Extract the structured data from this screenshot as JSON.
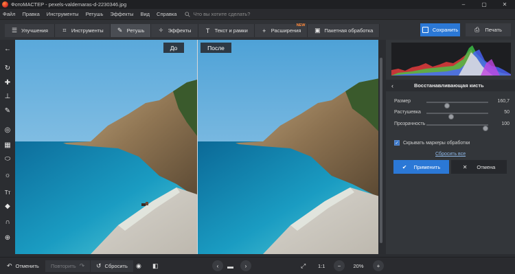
{
  "window": {
    "title": "ФотоМАСТЕР - pexels-valdemaras-d-2230346.jpg",
    "minimize": "–",
    "maximize": "▢",
    "close": "✕"
  },
  "menu": {
    "items": [
      "Файл",
      "Правка",
      "Инструменты",
      "Ретушь",
      "Эффекты",
      "Вид",
      "Справка"
    ],
    "search_placeholder": "Что вы хотите сделать?",
    "search_icon": "search-icon"
  },
  "toolbar": {
    "tabs": [
      {
        "label": "Улучшения",
        "icon": "sliders-icon"
      },
      {
        "label": "Инструменты",
        "icon": "crop-icon"
      },
      {
        "label": "Ретушь",
        "icon": "brush-icon",
        "active": true
      },
      {
        "label": "Эффекты",
        "icon": "sparkle-icon"
      },
      {
        "label": "Текст и рамки",
        "icon": "text-icon"
      },
      {
        "label": "Расширения",
        "icon": "plus-icon",
        "badge": "NEW"
      },
      {
        "label": "Пакетная обработка",
        "icon": "batch-icon"
      }
    ],
    "save_label": "Сохранить",
    "print_label": "Печать"
  },
  "left_tools": [
    {
      "name": "back-arrow-icon",
      "glyph": "←"
    },
    {
      "name": "rotate-icon",
      "glyph": "↻"
    },
    {
      "name": "bandage-icon",
      "glyph": "✚"
    },
    {
      "name": "stamp-icon",
      "glyph": "⊥"
    },
    {
      "name": "brush-icon",
      "glyph": "✎"
    },
    {
      "name": "target-brush-icon",
      "glyph": "◎"
    },
    {
      "name": "gradient-icon",
      "glyph": "▦"
    },
    {
      "name": "vignette-icon",
      "glyph": "⬭"
    },
    {
      "name": "sun-icon",
      "glyph": "☼"
    },
    {
      "name": "text-tool-icon",
      "glyph": "Tт"
    },
    {
      "name": "fill-icon",
      "glyph": "◆"
    },
    {
      "name": "magnet-icon",
      "glyph": "∩"
    },
    {
      "name": "aperture-icon",
      "glyph": "⊕"
    }
  ],
  "canvas": {
    "before_label": "До",
    "after_label": "После"
  },
  "panel": {
    "title": "Восстанавливающая кисть",
    "sliders": [
      {
        "label": "Размер",
        "value": "160,7",
        "level": 0.35
      },
      {
        "label": "Растушевка",
        "value": "50",
        "level": 0.42
      },
      {
        "label": "Прозрачность",
        "value": "100",
        "level": 1.0
      }
    ],
    "hide_markers_label": "Скрывать маркеры обработки",
    "hide_markers_checked": true,
    "reset_all_label": "Сбросить все",
    "apply_label": "Применить",
    "cancel_label": "Отмена"
  },
  "bottom": {
    "undo_label": "Отменить",
    "redo_label": "Повторить",
    "reset_label": "Сбросить",
    "zoom_one_label": "1:1",
    "zoom_value": "20%"
  },
  "colors": {
    "accent": "#2b78d6",
    "badge": "#ff8a3d"
  }
}
